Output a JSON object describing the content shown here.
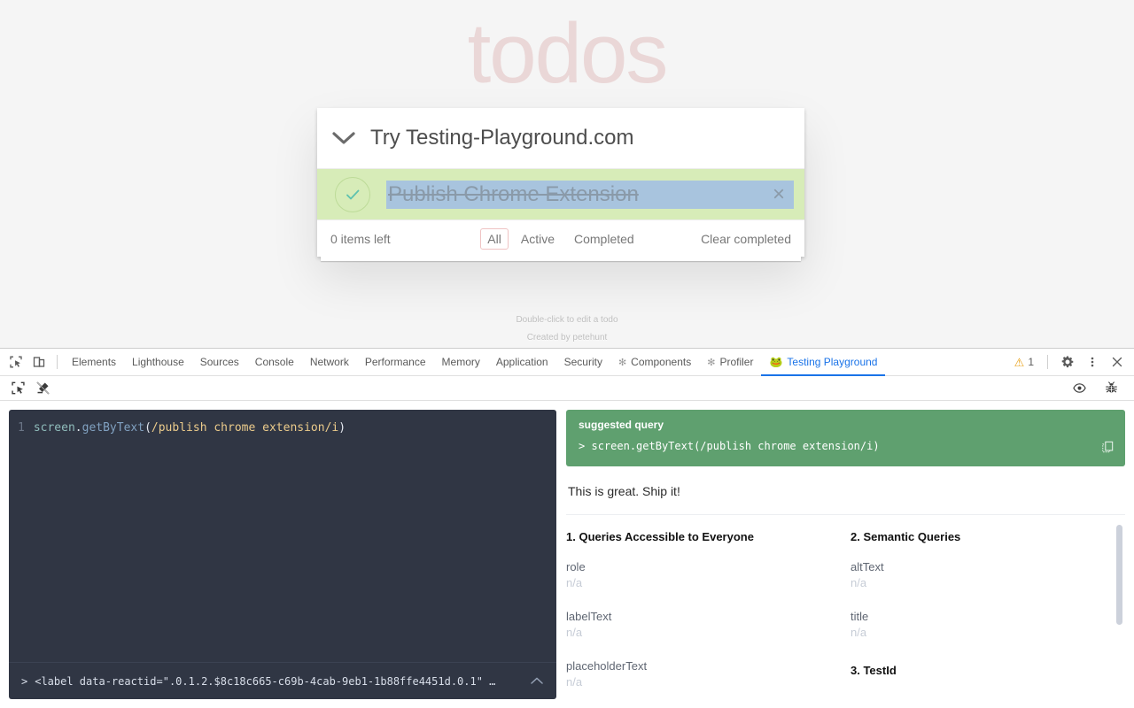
{
  "page": {
    "title": "todos",
    "new_todo_text": "Try Testing-Playground.com",
    "toggle_all_icon": "chevron-down-icon",
    "todo": {
      "label": "Publish Chrome Extension",
      "completed": true,
      "destroy_label": "×",
      "check_icon": "check-icon"
    },
    "footer": {
      "items_left": "0 items left",
      "filters": [
        {
          "label": "All",
          "selected": true
        },
        {
          "label": "Active",
          "selected": false
        },
        {
          "label": "Completed",
          "selected": false
        }
      ],
      "clear_completed": "Clear completed"
    },
    "info": {
      "line1": "Double-click to edit a todo",
      "line2": "Created by petehunt"
    }
  },
  "devtools": {
    "toolbar_icons": {
      "inspect": "inspect-element-icon",
      "device": "device-toolbar-icon"
    },
    "tabs": [
      {
        "label": "Elements",
        "icon": null,
        "active": false
      },
      {
        "label": "Lighthouse",
        "icon": null,
        "active": false
      },
      {
        "label": "Sources",
        "icon": null,
        "active": false
      },
      {
        "label": "Console",
        "icon": null,
        "active": false
      },
      {
        "label": "Network",
        "icon": null,
        "active": false
      },
      {
        "label": "Performance",
        "icon": null,
        "active": false
      },
      {
        "label": "Memory",
        "icon": null,
        "active": false
      },
      {
        "label": "Application",
        "icon": null,
        "active": false
      },
      {
        "label": "Security",
        "icon": null,
        "active": false
      },
      {
        "label": "Components",
        "icon": "react-atom-icon",
        "active": false
      },
      {
        "label": "Profiler",
        "icon": "react-atom-icon",
        "active": false
      },
      {
        "label": "Testing Playground",
        "icon": "🐸",
        "active": true
      }
    ],
    "warning_count": "1",
    "right_icons": {
      "warning": "warning-triangle-icon",
      "settings": "gear-icon",
      "more": "more-vertical-icon",
      "close": "close-icon"
    },
    "subbar": {
      "pick_icon": "element-picker-icon",
      "no_highlight_icon": "highlight-off-icon",
      "eye_icon": "eye-icon",
      "bug_icon": "bug-icon"
    },
    "editor": {
      "line_number": "1",
      "code": {
        "object": "screen",
        "dot": ".",
        "method": "getByText",
        "open_paren": "(",
        "regex": "/publish chrome extension/i",
        "close_paren": ")"
      },
      "status_prompt": ">",
      "status_text": "<label data-reactid=\".0.1.2.$8c18c665-c69b-4cab-9eb1-1b88ffe4451d.0.1\" …",
      "collapse_icon": "chevron-up-icon"
    },
    "results": {
      "suggested_label": "suggested query",
      "suggested_prompt": ">",
      "suggested_query": "screen.getByText(/publish chrome extension/i)",
      "copy_icon": "copy-icon",
      "note": "This is great. Ship it!",
      "columns": [
        {
          "heading": "1. Queries Accessible to Everyone",
          "fields": [
            {
              "key": "role",
              "value": "n/a"
            },
            {
              "key": "labelText",
              "value": "n/a"
            },
            {
              "key": "placeholderText",
              "value": "n/a"
            }
          ]
        },
        {
          "heading": "2. Semantic Queries",
          "fields": [
            {
              "key": "altText",
              "value": "n/a"
            },
            {
              "key": "title",
              "value": "n/a"
            }
          ],
          "heading2": "3. TestId"
        }
      ]
    }
  },
  "colors": {
    "accent_blue": "#1a73e8",
    "suggested_green": "#5fa06f",
    "todo_completed_bg": "#d7ecb8",
    "selection_blue": "#a8c4de",
    "editor_bg": "#303644",
    "warning_amber": "#e9a21a",
    "title_pink": "#ead7d7"
  }
}
